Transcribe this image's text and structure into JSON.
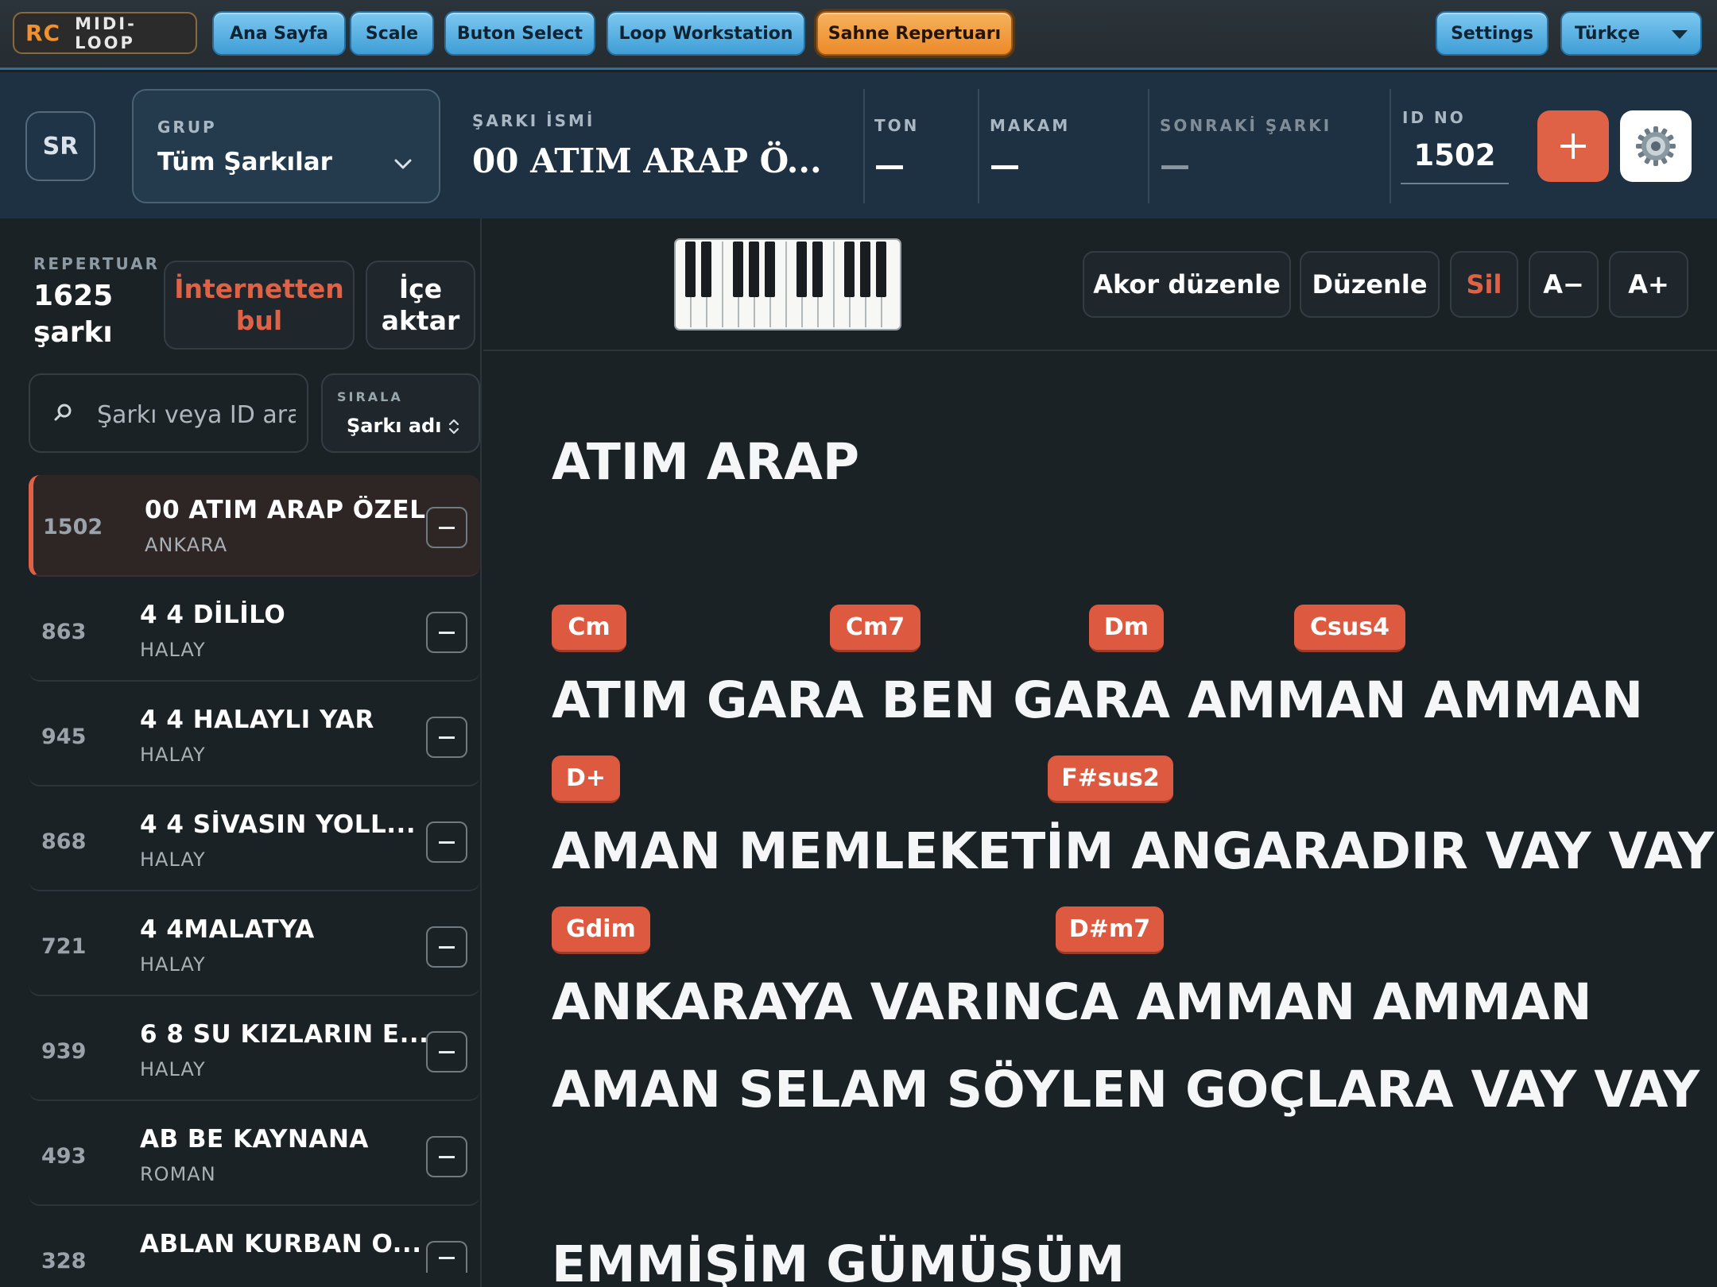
{
  "brand": {
    "rc": "RC",
    "name": "MIDI-LOOP"
  },
  "nav": {
    "items": [
      "Ana Sayfa",
      "Scale",
      "Buton Select",
      "Loop Workstation",
      "Sahne Repertuarı"
    ],
    "settings": "Settings",
    "language": "Türkçe"
  },
  "header": {
    "avatar": "SR",
    "grup_label": "GRUP",
    "grup_value": "Tüm Şarkılar",
    "sarki_label": "ŞARKI İSMİ",
    "sarki_value": "00 ATIM ARAP Ö...",
    "ton_label": "TON",
    "ton_value": "—",
    "makam_label": "MAKAM",
    "makam_value": "—",
    "sonraki_label": "SONRAKİ ŞARKI",
    "sonraki_value": "—",
    "id_label": "ID NO",
    "id_value": "1502",
    "plus": "+"
  },
  "sidebar": {
    "rep_label": "REPERTUAR",
    "rep_count": "1625 şarkı",
    "internet_btn": "İnternetten bul",
    "import_btn": "İçe aktar",
    "search_placeholder": "Şarkı veya ID ara",
    "sort_label": "SIRALA",
    "sort_value": "Şarkı adı",
    "songs": [
      {
        "id": "1502",
        "title": "00 ATIM ARAP ÖZEL",
        "sub": "ANKARA",
        "active": true
      },
      {
        "id": "863",
        "title": "4 4 DİLİLO",
        "sub": "HALAY"
      },
      {
        "id": "945",
        "title": "4 4 HALAYLI YAR",
        "sub": "HALAY"
      },
      {
        "id": "868",
        "title": "4 4 SİVASIN YOLL...",
        "sub": "HALAY"
      },
      {
        "id": "721",
        "title": "4 4MALATYA",
        "sub": "HALAY"
      },
      {
        "id": "939",
        "title": "6 8 SU KIZLARIN E...",
        "sub": "HALAY"
      },
      {
        "id": "493",
        "title": "AB BE KAYNANA",
        "sub": "ROMAN"
      },
      {
        "id": "328",
        "title": "ABLAN KURBAN O...",
        "sub": ""
      }
    ]
  },
  "toolbar": {
    "akor": "Akor düzenle",
    "duzenle": "Düzenle",
    "sil": "Sil",
    "font_minus": "A−",
    "font_plus": "A+"
  },
  "lyrics": {
    "heading": "ATIM ARAP",
    "lines": [
      "ATIM GARA BEN GARA AMMAN AMMAN",
      "AMAN MEMLEKETİM ANGARADIR VAY VAY",
      "ANKARAYA VARINCA AMMAN AMMAN",
      "AMAN SELAM SÖYLEN GOÇLARA VAY VAY",
      "EMMİŞİM GÜMÜŞÜM"
    ],
    "chords": {
      "line1": [
        "Cm",
        "Cm7",
        "Dm",
        "Csus4"
      ],
      "line2": [
        "D+",
        "F#sus2"
      ],
      "line3": [
        "Gdim",
        "D#m7"
      ]
    }
  },
  "colors": {
    "accent_orange": "#e06246",
    "nav_blue": "#3f9ed6",
    "nav_active": "#ec8a2a",
    "header_bg": "#1d3142",
    "page_bg": "#1b2226"
  }
}
